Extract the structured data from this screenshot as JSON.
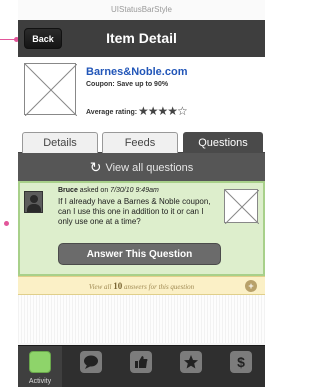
{
  "statusbar": {
    "label": "UIStatusBarStyle"
  },
  "navbar": {
    "back_label": "Back",
    "title": "Item Detail"
  },
  "item": {
    "name": "Barnes&Noble.com",
    "coupon": "Coupon: Save up to 90%",
    "rating_label": "Average rating:",
    "rating": {
      "filled": 4,
      "max": 5
    },
    "stars_text": "★★★★☆"
  },
  "tabs": [
    {
      "label": "Details",
      "active": false
    },
    {
      "label": "Feeds",
      "active": false
    },
    {
      "label": "Questions",
      "active": true
    }
  ],
  "view_all": {
    "label": "View all questions"
  },
  "question": {
    "author": "Bruce",
    "asked_on": "asked on",
    "timestamp": "7/30/10 9:49am",
    "text": "If I already have a Barnes & Noble coupon, can I use this one in addition to it or can I only use one at a time?",
    "answer_button": "Answer This Question"
  },
  "answers_bar": {
    "prefix": "View all",
    "count": "10",
    "suffix": "answers for this question",
    "plus_icon": "+"
  },
  "tabbar": {
    "items": [
      {
        "icon": "activity-icon",
        "label": "Activity",
        "active": true
      },
      {
        "icon": "chat-bubble-icon",
        "label": "",
        "active": false
      },
      {
        "icon": "thumbs-up-icon",
        "label": "",
        "active": false
      },
      {
        "icon": "star-icon",
        "label": "",
        "active": false
      },
      {
        "icon": "dollar-icon",
        "label": "",
        "active": false
      }
    ]
  },
  "colors": {
    "nav_bg": "#3e3e3e",
    "link_blue": "#2256b8",
    "question_bg": "#ddeecc",
    "question_border": "#a8d08a",
    "answers_bar_bg": "#fbf0c6",
    "active_tab_green": "#8ed46a",
    "annotation_pink": "#e2569a"
  }
}
